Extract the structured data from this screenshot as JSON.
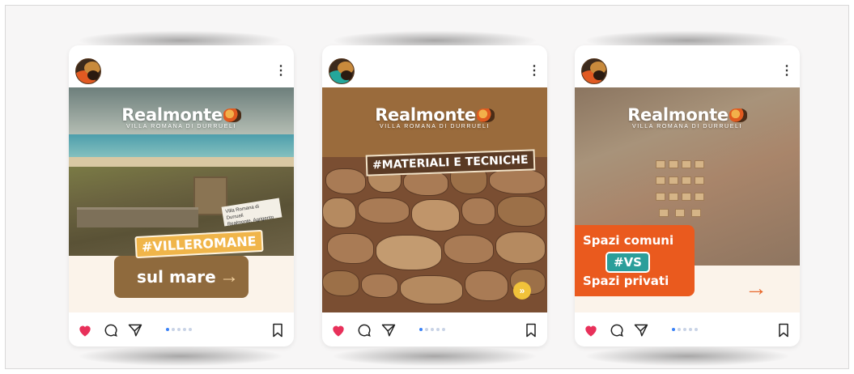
{
  "cards": [
    {
      "brand_title": "Realmonte",
      "brand_subtitle": "VILLA ROMANA DI DURRUELI",
      "hashtag": "#VILLEROMANE",
      "headline": "sul mare",
      "placard_line1": "Villa Romana di Durrueli",
      "placard_line2": "Realmonte, Agrigento",
      "arrow": "→"
    },
    {
      "brand_title": "Realmonte",
      "brand_subtitle": "VILLA ROMANA DI DURRUELI",
      "hashtag": "#MATERIALI E TECNICHE",
      "next_glyph": "»"
    },
    {
      "brand_title": "Realmonte",
      "brand_subtitle": "VILLA ROMANA DI DURRUELI",
      "line1": "Spazi comuni",
      "vs": "#VS",
      "line2": "Spazi privati",
      "arrow": "→"
    }
  ],
  "ui": {
    "menu_glyph": "⋮",
    "colors": {
      "like": "#e8305a",
      "dot_active": "#3a82f7",
      "dot_inactive": "#c8d3e6"
    },
    "icons": [
      "heart-icon",
      "comment-icon",
      "share-icon",
      "bookmark-icon",
      "more-vertical-icon"
    ],
    "carousel": {
      "slides": 5,
      "active": 1
    }
  }
}
